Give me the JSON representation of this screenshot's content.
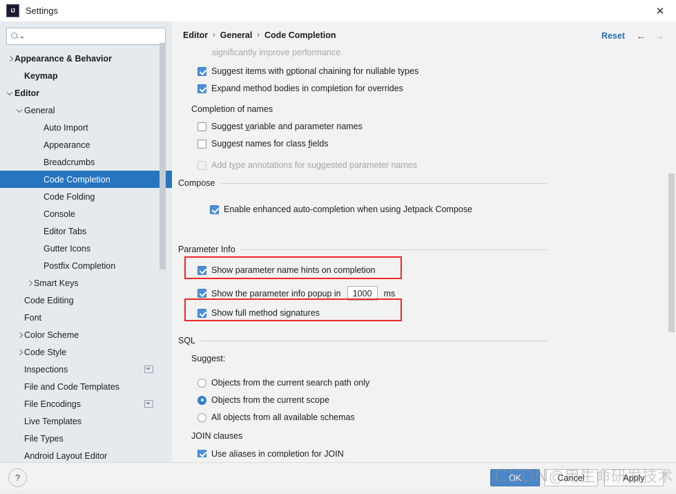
{
  "window": {
    "title": "Settings",
    "logo_text": "IJ",
    "close_icon": "close-icon"
  },
  "sidebar": {
    "search": {
      "value": "",
      "placeholder": ""
    },
    "items": [
      {
        "label": "Appearance & Behavior",
        "indent": 0,
        "bold": true,
        "arrow": "collapsed",
        "selected": false,
        "badge": false
      },
      {
        "label": "Keymap",
        "indent": 1,
        "bold": true,
        "arrow": "none",
        "selected": false,
        "badge": false
      },
      {
        "label": "Editor",
        "indent": 0,
        "bold": true,
        "arrow": "expanded",
        "selected": false,
        "badge": false
      },
      {
        "label": "General",
        "indent": 1,
        "bold": false,
        "arrow": "expanded",
        "selected": false,
        "badge": false
      },
      {
        "label": "Auto Import",
        "indent": 3,
        "bold": false,
        "arrow": "none",
        "selected": false,
        "badge": false
      },
      {
        "label": "Appearance",
        "indent": 3,
        "bold": false,
        "arrow": "none",
        "selected": false,
        "badge": false
      },
      {
        "label": "Breadcrumbs",
        "indent": 3,
        "bold": false,
        "arrow": "none",
        "selected": false,
        "badge": false
      },
      {
        "label": "Code Completion",
        "indent": 3,
        "bold": false,
        "arrow": "none",
        "selected": true,
        "badge": false
      },
      {
        "label": "Code Folding",
        "indent": 3,
        "bold": false,
        "arrow": "none",
        "selected": false,
        "badge": false
      },
      {
        "label": "Console",
        "indent": 3,
        "bold": false,
        "arrow": "none",
        "selected": false,
        "badge": false
      },
      {
        "label": "Editor Tabs",
        "indent": 3,
        "bold": false,
        "arrow": "none",
        "selected": false,
        "badge": false
      },
      {
        "label": "Gutter Icons",
        "indent": 3,
        "bold": false,
        "arrow": "none",
        "selected": false,
        "badge": false
      },
      {
        "label": "Postfix Completion",
        "indent": 3,
        "bold": false,
        "arrow": "none",
        "selected": false,
        "badge": false
      },
      {
        "label": "Smart Keys",
        "indent": 2,
        "bold": false,
        "arrow": "collapsed",
        "selected": false,
        "badge": false
      },
      {
        "label": "Code Editing",
        "indent": 1,
        "bold": false,
        "arrow": "none",
        "selected": false,
        "badge": false
      },
      {
        "label": "Font",
        "indent": 1,
        "bold": false,
        "arrow": "none",
        "selected": false,
        "badge": false
      },
      {
        "label": "Color Scheme",
        "indent": 1,
        "bold": false,
        "arrow": "collapsed",
        "selected": false,
        "badge": false
      },
      {
        "label": "Code Style",
        "indent": 1,
        "bold": false,
        "arrow": "collapsed",
        "selected": false,
        "badge": false
      },
      {
        "label": "Inspections",
        "indent": 1,
        "bold": false,
        "arrow": "none",
        "selected": false,
        "badge": true
      },
      {
        "label": "File and Code Templates",
        "indent": 1,
        "bold": false,
        "arrow": "none",
        "selected": false,
        "badge": false
      },
      {
        "label": "File Encodings",
        "indent": 1,
        "bold": false,
        "arrow": "none",
        "selected": false,
        "badge": true
      },
      {
        "label": "Live Templates",
        "indent": 1,
        "bold": false,
        "arrow": "none",
        "selected": false,
        "badge": false
      },
      {
        "label": "File Types",
        "indent": 1,
        "bold": false,
        "arrow": "none",
        "selected": false,
        "badge": false
      },
      {
        "label": "Android Layout Editor",
        "indent": 1,
        "bold": false,
        "arrow": "none",
        "selected": false,
        "badge": false
      }
    ]
  },
  "header": {
    "breadcrumb": [
      "Editor",
      "General",
      "Code Completion"
    ],
    "separator": "›",
    "reset_label": "Reset",
    "back_icon": "arrow-left-icon",
    "forward_icon": "arrow-right-icon"
  },
  "content": {
    "truncated_top_text": "significantly improve performance.",
    "checkbox_top_1": {
      "label_pre": "Suggest items with ",
      "mnemonic": "o",
      "label_post": "ptional chaining for nullable types",
      "checked": true
    },
    "checkbox_top_2": {
      "label": "Expand method bodies in completion for overrides",
      "checked": true
    },
    "completion_of_names_label": "Completion of names",
    "name_options": [
      {
        "label_pre": "Suggest ",
        "mnemonic": "v",
        "label_post": "ariable and parameter names",
        "checked": false,
        "disabled": false
      },
      {
        "label_pre": "Suggest names for class ",
        "mnemonic": "f",
        "label_post": "ields",
        "checked": false,
        "disabled": false
      },
      {
        "label_pre": "Add t",
        "mnemonic": "y",
        "label_post": "pe annotations for suggested parameter names",
        "checked": false,
        "disabled": true
      }
    ],
    "compose": {
      "group_title": "Compose",
      "checkbox": {
        "label": "Enable enhanced auto-completion when using Jetpack Compose",
        "checked": true
      }
    },
    "parameter_info": {
      "group_title": "Parameter Info",
      "show_hints": {
        "label": "Show parameter name hints on completion",
        "checked": true,
        "annotated": true
      },
      "popup_delay": {
        "label": "Show the parameter info popup in",
        "checked": true,
        "value": "1000",
        "unit": "ms"
      },
      "full_signatures": {
        "label": "Show full method signatures",
        "checked": true,
        "annotated": true
      }
    },
    "sql": {
      "group_title": "SQL",
      "suggest_label": "Suggest:",
      "radios": [
        {
          "label": "Objects from the current search path only",
          "selected": false
        },
        {
          "label": "Objects from the current scope",
          "selected": true
        },
        {
          "label": "All objects from all available schemas",
          "selected": false
        }
      ],
      "join_label": "JOIN clauses",
      "join_checkbox": {
        "label": "Use aliases in completion for JOIN",
        "checked": true
      }
    }
  },
  "footer": {
    "help_label": "?",
    "ok_label": "OK",
    "cancel_label": "Cancel",
    "apply_label": "Apply"
  },
  "watermark": {
    "brand": "CSDN",
    "handle": "@用生命研发技术"
  },
  "colors": {
    "selection_blue": "#2675bf",
    "accent_blue": "#4a90d9",
    "link_blue": "#2470b3",
    "annotation_red": "#ee2824",
    "sidebar_bg": "#e5eaee",
    "panel_bg": "#f2f2f2"
  }
}
